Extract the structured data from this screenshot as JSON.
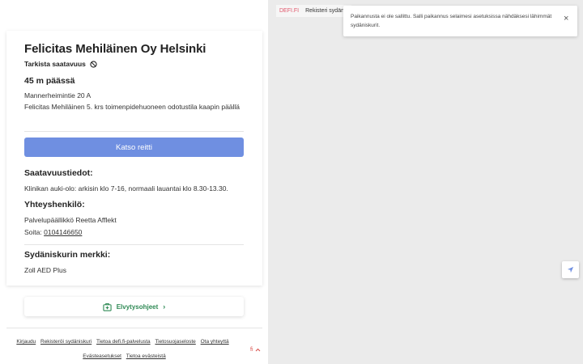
{
  "site": {
    "title": "Felicitas Mehiläinen Oy Helsinki",
    "check_availability": "Tarkista saatavuus",
    "distance": "45 m päässä",
    "address_line1": "Mannerheimintie 20 A",
    "address_line2": "Felicitas Mehiläinen 5. krs toimenpidehuoneen odotustila kaapin päällä",
    "route_button": "Katso reitti"
  },
  "availability": {
    "heading": "Saatavuustiedot:",
    "text": "Klinikan auki-olo: arkisin klo 7-16, normaali lauantai klo 8.30-13.30."
  },
  "contact": {
    "heading": "Yhteyshenkilö:",
    "name": "Palvelupäällikkö Reetta Afflekt",
    "phone_label": "Soita:",
    "phone": "0104146650"
  },
  "device": {
    "heading": "Sydäniskurin merkki:",
    "brand": "Zoll AED Plus"
  },
  "cpr": {
    "label": "Elvytysohjeet",
    "chevron": "›"
  },
  "footer": {
    "links": [
      "Kirjaudu",
      "Rekisteröi sydäniskuri",
      "Tietoa defi.fi-palvelusta",
      "Tietosuojaseloste",
      "Ota yhteyttä"
    ],
    "links2": [
      "Evästeasetukset",
      "Tietoa evästeistä"
    ],
    "language": "fi",
    "language_chevron": "^"
  },
  "map": {
    "tab_defi": "DEFI.FI",
    "tab_register": "Rekisteri sydänis",
    "toast_text": "Paikannusta ei ole sallittu. Salli paikannus selaimesi asetuksissa nähdäksesi lähimmät sydäniskurit.",
    "toast_close": "×"
  },
  "colors": {
    "primary_button": "#6f8fe1",
    "cpr_green": "#2f8a55",
    "defi_red": "#e0566a",
    "map_bg": "#ebebeb"
  }
}
